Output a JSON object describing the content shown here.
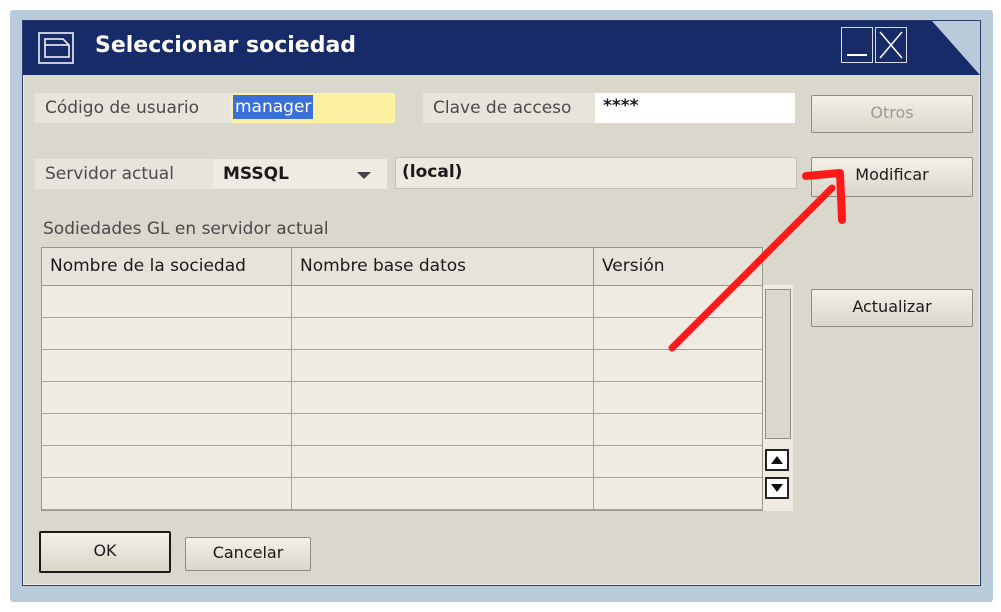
{
  "window": {
    "title": "Seleccionar sociedad"
  },
  "user": {
    "label": "Código de usuario",
    "value": "manager"
  },
  "password": {
    "label": "Clave de acceso",
    "value": "****"
  },
  "server": {
    "label": "Servidor actual",
    "type_value": "MSSQL",
    "name_value": "(local)"
  },
  "buttons": {
    "otros": "Otros",
    "modificar": "Modificar",
    "actualizar": "Actualizar",
    "ok": "OK",
    "cancelar": "Cancelar"
  },
  "companies": {
    "section_title": "Sodiedades GL en servidor actual",
    "columns": [
      "Nombre de la sociedad",
      "Nombre base datos",
      "Versión"
    ],
    "rows": [
      [
        "",
        "",
        ""
      ],
      [
        "",
        "",
        ""
      ],
      [
        "",
        "",
        ""
      ],
      [
        "",
        "",
        ""
      ],
      [
        "",
        "",
        ""
      ],
      [
        "",
        "",
        ""
      ],
      [
        "",
        "",
        ""
      ]
    ]
  },
  "icons": {
    "window_icon": "folder-window-icon",
    "minimize": "minimize-icon",
    "close": "close-icon",
    "dropdown": "chevron-down-icon",
    "scroll_up": "arrow-up-icon",
    "scroll_down": "arrow-down-icon"
  },
  "colors": {
    "titlebar": "#172b68",
    "window_bg": "#dad7cc",
    "user_highlight": "#fdf0a0",
    "selection": "#3a6fd8",
    "annotation_arrow": "#ff1a1a"
  }
}
